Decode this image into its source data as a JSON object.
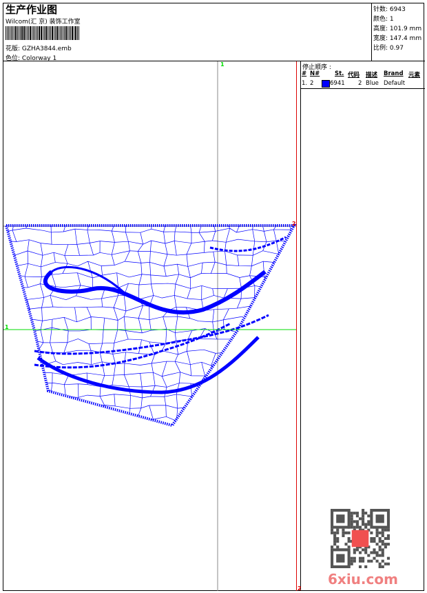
{
  "header": {
    "title": "生产作业图",
    "company": "Wilcom(汇 京) 装饰工作室",
    "design_label": "花版:",
    "design_file": "GZHA3844.emb",
    "colorway_label": "色位:",
    "colorway": "Colorway 1"
  },
  "info": [
    {
      "label": "针数:",
      "value": "6943"
    },
    {
      "label": "颜色:",
      "value": "1"
    },
    {
      "label": "高度:",
      "value": "101.9 mm"
    },
    {
      "label": "宽度:",
      "value": "147.4 mm"
    },
    {
      "label": "比例:",
      "value": "0.97"
    }
  ],
  "stop_sequence": {
    "title": "停止顺序 :",
    "columns": [
      "#",
      "N#",
      "St.",
      "代码",
      "描述",
      "Brand",
      "元素"
    ],
    "rows": [
      {
        "index": "1.",
        "n": "2",
        "color": "#0000ff",
        "stitches": "6941",
        "code": "2",
        "desc": "Blue",
        "brand": "Default"
      }
    ]
  },
  "markers": {
    "top": "1",
    "left": "1",
    "right_top": "2",
    "right_bottom": "2"
  },
  "watermark": "6xiu.com",
  "colors": {
    "thread": "#0000ff",
    "guide_green": "#00dd00",
    "guide_red": "#dd0000"
  }
}
